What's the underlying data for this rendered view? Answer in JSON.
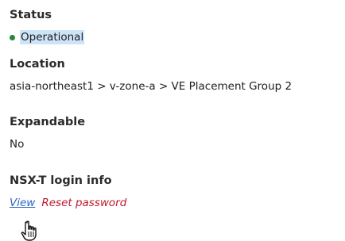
{
  "status": {
    "label": "Status",
    "value": "Operational",
    "indicator_color": "#1f8a3a"
  },
  "location": {
    "label": "Location",
    "value": "asia-northeast1 > v-zone-a > VE Placement Group 2"
  },
  "expandable": {
    "label": "Expandable",
    "value": "No"
  },
  "nsx_login": {
    "label": "NSX-T login info",
    "view_link": "View",
    "reset_link": "Reset password"
  },
  "colors": {
    "link": "#2b64c6",
    "danger_link": "#c0172f",
    "selection": "#cde3f7"
  },
  "cursor": {
    "icon": "hand-pointer-icon"
  }
}
